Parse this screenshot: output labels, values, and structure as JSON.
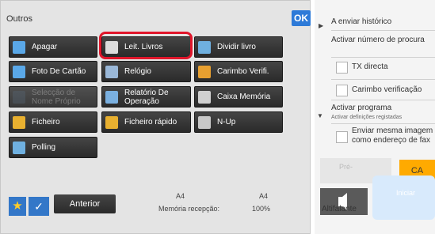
{
  "panel": {
    "title": "Outros",
    "ok_label": "OK"
  },
  "buttons": [
    {
      "label": "Apagar",
      "icon": "erase-icon",
      "icon_color": "#5aa8e8",
      "enabled": true
    },
    {
      "label": "Leit. Livros",
      "icon": "book-scan-icon",
      "icon_color": "#dcdcdc",
      "enabled": true,
      "highlighted": true
    },
    {
      "label": "Dividir livro",
      "icon": "book-divide-icon",
      "icon_color": "#6fb0e0",
      "enabled": true
    },
    {
      "label": "Foto De Cartão",
      "icon": "card-shot-icon",
      "icon_color": "#5aa8e8",
      "enabled": true
    },
    {
      "label": "Relógio",
      "icon": "clock-icon",
      "icon_color": "#9ab8d8",
      "enabled": true
    },
    {
      "label": "Carimbo Verifi.",
      "icon": "stamp-icon",
      "icon_color": "#e8a030",
      "enabled": true
    },
    {
      "label": "Selecção de Nome Próprio",
      "icon": "name-select-icon",
      "icon_color": "#5a6a7a",
      "enabled": false
    },
    {
      "label": "Relatório De Operação",
      "icon": "report-icon",
      "icon_color": "#7ab0e0",
      "enabled": true
    },
    {
      "label": "Caixa Memória",
      "icon": "memory-box-icon",
      "icon_color": "#d0d0d0",
      "enabled": true
    },
    {
      "label": "Ficheiro",
      "icon": "folder-icon",
      "icon_color": "#e8b030",
      "enabled": true
    },
    {
      "label": "Ficheiro rápido",
      "icon": "quick-folder-icon",
      "icon_color": "#e8b030",
      "enabled": true
    },
    {
      "label": "N-Up",
      "icon": "n-up-icon",
      "icon_color": "#c8c8c8",
      "enabled": true
    },
    {
      "label": "Polling",
      "icon": "polling-icon",
      "icon_color": "#6fb0e0",
      "enabled": true
    }
  ],
  "bottom": {
    "anterior_label": "Anterior",
    "paper_left": "A4",
    "paper_right": "A4",
    "memory_label": "Memória recepção:",
    "memory_value": "100%"
  },
  "right": {
    "history": "A enviar histórico",
    "activate_number": "Activar número de procura",
    "tx_direct": "TX directa",
    "stamp_check": "Carimbo verificação",
    "activate_program": "Activar programa",
    "registered_settings": "Activar definições registadas",
    "send_same_image": "Enviar mesma imagem como endereço de fax",
    "pre_label": "Pré-",
    "ca_label": "CA",
    "speaker_label": "Altifalante",
    "start_label": "Iniciar"
  },
  "colors": {
    "highlight": "#e0162b",
    "accent": "#2d7ad8",
    "ca": "#ffaa00"
  }
}
